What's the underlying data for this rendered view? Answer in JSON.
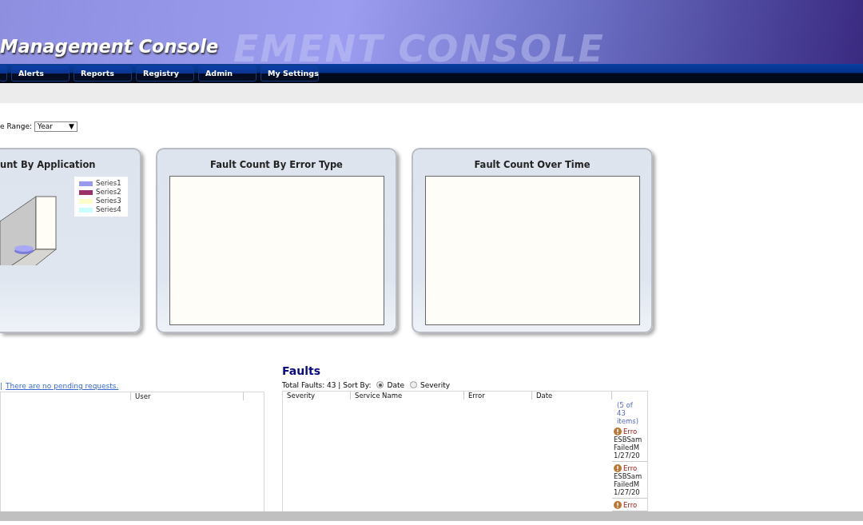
{
  "header": {
    "title": "Management Console",
    "banner_text": "EMENT CONSOLE"
  },
  "nav_tabs": [
    {
      "kind": "stub"
    },
    {
      "kind": "tab",
      "label": "Alerts"
    },
    {
      "kind": "tab",
      "label": "Reports"
    },
    {
      "kind": "tab",
      "label": "Registry"
    },
    {
      "kind": "tab",
      "label": "Admin"
    },
    {
      "kind": "tab",
      "label": "My Settings"
    }
  ],
  "date_range": {
    "label": "e Range:",
    "value": "Year",
    "caret": "▼"
  },
  "cards": [
    {
      "title": "unt By Application",
      "kind": "chart",
      "legend": [
        {
          "name": "Series1",
          "color": "#9999ee"
        },
        {
          "name": "Series2",
          "color": "#993366"
        },
        {
          "name": "Series3",
          "color": "#ffffcc"
        },
        {
          "name": "Series4",
          "color": "#ccffff"
        }
      ]
    },
    {
      "title": "Fault Count By Error Type",
      "kind": "empty"
    },
    {
      "title": "Fault Count Over Time",
      "kind": "empty"
    }
  ],
  "requests": {
    "separator": "|",
    "message": "There are no pending requests.",
    "columns": [
      "User"
    ]
  },
  "faults": {
    "title": "Faults",
    "total": "Total Faults: 43 | Sort By:",
    "sort_options": [
      {
        "label": "Date",
        "selected": true
      },
      {
        "label": "Severity",
        "selected": false
      }
    ],
    "columns": [
      "Severity",
      "Service Name",
      "Error",
      "Date"
    ],
    "pager": "(5 of 43 items)",
    "items": [
      {
        "severity": "Erro",
        "service": "ESBSam",
        "error": "FailedM",
        "date": "1/27/20"
      },
      {
        "severity": "Erro",
        "service": "ESBSam",
        "error": "FailedM",
        "date": "1/27/20"
      },
      {
        "severity": "Erro"
      }
    ]
  }
}
